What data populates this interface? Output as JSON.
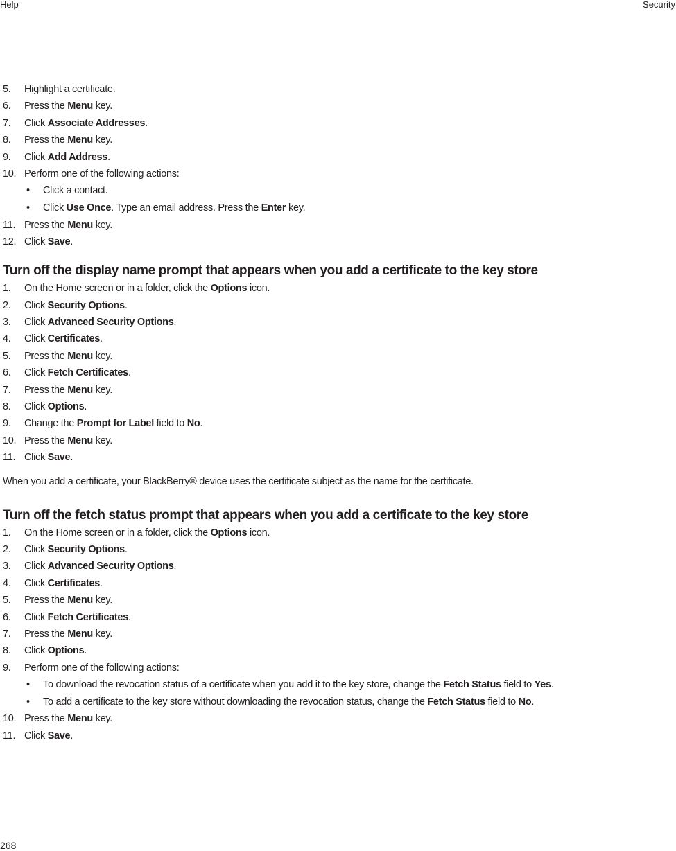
{
  "header": {
    "left": "Help",
    "right": "Security"
  },
  "footer": {
    "page_number": "268"
  },
  "section0": {
    "steps": [
      {
        "num": "5.",
        "parts": [
          [
            "t",
            "Highlight a certificate."
          ]
        ]
      },
      {
        "num": "6.",
        "parts": [
          [
            "t",
            "Press the "
          ],
          [
            "b",
            "Menu"
          ],
          [
            "t",
            " key."
          ]
        ]
      },
      {
        "num": "7.",
        "parts": [
          [
            "t",
            "Click "
          ],
          [
            "b",
            "Associate Addresses"
          ],
          [
            "t",
            "."
          ]
        ]
      },
      {
        "num": "8.",
        "parts": [
          [
            "t",
            "Press the "
          ],
          [
            "b",
            "Menu"
          ],
          [
            "t",
            " key."
          ]
        ]
      },
      {
        "num": "9.",
        "parts": [
          [
            "t",
            "Click "
          ],
          [
            "b",
            "Add Address"
          ],
          [
            "t",
            "."
          ]
        ]
      },
      {
        "num": "10.",
        "parts": [
          [
            "t",
            "Perform one of the following actions:"
          ]
        ],
        "bullets": [
          [
            [
              "t",
              "Click a contact."
            ]
          ],
          [
            [
              "t",
              "Click "
            ],
            [
              "b",
              "Use Once"
            ],
            [
              "t",
              ". Type an email address. Press the "
            ],
            [
              "b",
              "Enter"
            ],
            [
              "t",
              " key."
            ]
          ]
        ]
      },
      {
        "num": "11.",
        "parts": [
          [
            "t",
            "Press the "
          ],
          [
            "b",
            "Menu"
          ],
          [
            "t",
            " key."
          ]
        ]
      },
      {
        "num": "12.",
        "parts": [
          [
            "t",
            "Click "
          ],
          [
            "b",
            "Save"
          ],
          [
            "t",
            "."
          ]
        ]
      }
    ]
  },
  "section1": {
    "title": "Turn off the display name prompt that appears when you add a certificate to the key store",
    "steps": [
      {
        "num": "1.",
        "parts": [
          [
            "t",
            "On the Home screen or in a folder, click the "
          ],
          [
            "b",
            "Options"
          ],
          [
            "t",
            " icon."
          ]
        ]
      },
      {
        "num": "2.",
        "parts": [
          [
            "t",
            "Click "
          ],
          [
            "b",
            "Security Options"
          ],
          [
            "t",
            "."
          ]
        ]
      },
      {
        "num": "3.",
        "parts": [
          [
            "t",
            "Click "
          ],
          [
            "b",
            "Advanced Security Options"
          ],
          [
            "t",
            "."
          ]
        ]
      },
      {
        "num": "4.",
        "parts": [
          [
            "t",
            "Click "
          ],
          [
            "b",
            "Certificates"
          ],
          [
            "t",
            "."
          ]
        ]
      },
      {
        "num": "5.",
        "parts": [
          [
            "t",
            "Press the "
          ],
          [
            "b",
            "Menu"
          ],
          [
            "t",
            " key."
          ]
        ]
      },
      {
        "num": "6.",
        "parts": [
          [
            "t",
            "Click "
          ],
          [
            "b",
            "Fetch Certificates"
          ],
          [
            "t",
            "."
          ]
        ]
      },
      {
        "num": "7.",
        "parts": [
          [
            "t",
            "Press the "
          ],
          [
            "b",
            "Menu"
          ],
          [
            "t",
            " key."
          ]
        ]
      },
      {
        "num": "8.",
        "parts": [
          [
            "t",
            "Click "
          ],
          [
            "b",
            "Options"
          ],
          [
            "t",
            "."
          ]
        ]
      },
      {
        "num": "9.",
        "parts": [
          [
            "t",
            "Change the "
          ],
          [
            "b",
            "Prompt for Label"
          ],
          [
            "t",
            " field to "
          ],
          [
            "b",
            "No"
          ],
          [
            "t",
            "."
          ]
        ]
      },
      {
        "num": "10.",
        "parts": [
          [
            "t",
            "Press the "
          ],
          [
            "b",
            "Menu"
          ],
          [
            "t",
            " key."
          ]
        ]
      },
      {
        "num": "11.",
        "parts": [
          [
            "t",
            "Click "
          ],
          [
            "b",
            "Save"
          ],
          [
            "t",
            "."
          ]
        ]
      }
    ],
    "note": "When you add a certificate, your BlackBerry® device uses the certificate subject as the name for the certificate."
  },
  "section2": {
    "title": "Turn off the fetch status prompt that appears when you add a certificate to the key store",
    "steps": [
      {
        "num": "1.",
        "parts": [
          [
            "t",
            "On the Home screen or in a folder, click the "
          ],
          [
            "b",
            "Options"
          ],
          [
            "t",
            " icon."
          ]
        ]
      },
      {
        "num": "2.",
        "parts": [
          [
            "t",
            "Click "
          ],
          [
            "b",
            "Security Options"
          ],
          [
            "t",
            "."
          ]
        ]
      },
      {
        "num": "3.",
        "parts": [
          [
            "t",
            "Click "
          ],
          [
            "b",
            "Advanced Security Options"
          ],
          [
            "t",
            "."
          ]
        ]
      },
      {
        "num": "4.",
        "parts": [
          [
            "t",
            "Click "
          ],
          [
            "b",
            "Certificates"
          ],
          [
            "t",
            "."
          ]
        ]
      },
      {
        "num": "5.",
        "parts": [
          [
            "t",
            "Press the "
          ],
          [
            "b",
            "Menu"
          ],
          [
            "t",
            " key."
          ]
        ]
      },
      {
        "num": "6.",
        "parts": [
          [
            "t",
            "Click "
          ],
          [
            "b",
            "Fetch Certificates"
          ],
          [
            "t",
            "."
          ]
        ]
      },
      {
        "num": "7.",
        "parts": [
          [
            "t",
            "Press the "
          ],
          [
            "b",
            "Menu"
          ],
          [
            "t",
            " key."
          ]
        ]
      },
      {
        "num": "8.",
        "parts": [
          [
            "t",
            "Click "
          ],
          [
            "b",
            "Options"
          ],
          [
            "t",
            "."
          ]
        ]
      },
      {
        "num": "9.",
        "parts": [
          [
            "t",
            "Perform one of the following actions:"
          ]
        ],
        "bullets": [
          [
            [
              "t",
              "To download the revocation status of a certificate when you add it to the key store, change the "
            ],
            [
              "b",
              "Fetch Status"
            ],
            [
              "t",
              " field to "
            ],
            [
              "b",
              "Yes"
            ],
            [
              "t",
              "."
            ]
          ],
          [
            [
              "t",
              "To add a certificate to the key store without downloading the revocation status, change the "
            ],
            [
              "b",
              "Fetch Status"
            ],
            [
              "t",
              " field to "
            ],
            [
              "b",
              "No"
            ],
            [
              "t",
              "."
            ]
          ]
        ]
      },
      {
        "num": "10.",
        "parts": [
          [
            "t",
            "Press the "
          ],
          [
            "b",
            "Menu"
          ],
          [
            "t",
            " key."
          ]
        ]
      },
      {
        "num": "11.",
        "parts": [
          [
            "t",
            "Click "
          ],
          [
            "b",
            "Save"
          ],
          [
            "t",
            "."
          ]
        ]
      }
    ]
  },
  "bullet_glyph": "•"
}
